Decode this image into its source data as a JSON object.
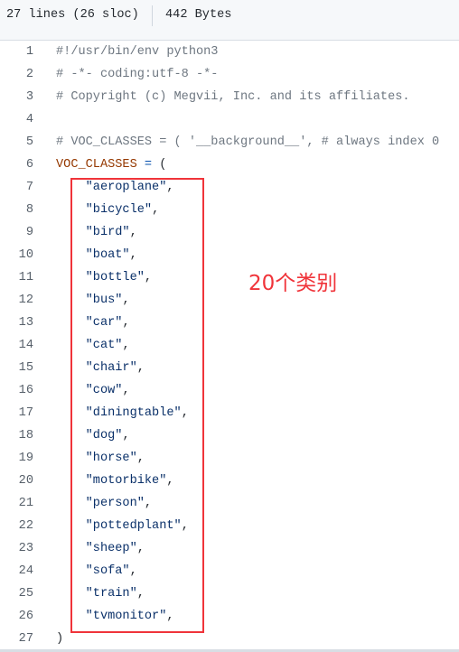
{
  "header": {
    "lines_info": "27 lines (26 sloc)",
    "size": "442 Bytes"
  },
  "code": {
    "line_numbers": [
      "1",
      "2",
      "3",
      "4",
      "5",
      "6",
      "7",
      "8",
      "9",
      "10",
      "11",
      "12",
      "13",
      "14",
      "15",
      "16",
      "17",
      "18",
      "19",
      "20",
      "21",
      "22",
      "23",
      "24",
      "25",
      "26",
      "27"
    ],
    "line1": "#!/usr/bin/env python3",
    "line2": "# -*- coding:utf-8 -*-",
    "line3": "# Copyright (c) Megvii, Inc. and its affiliates.",
    "line5": "# VOC_CLASSES = ( '__background__', # always index 0",
    "line6_var": "VOC_CLASSES",
    "line6_op": " = ",
    "line6_paren": "(",
    "classes": [
      "\"aeroplane\"",
      "\"bicycle\"",
      "\"bird\"",
      "\"boat\"",
      "\"bottle\"",
      "\"bus\"",
      "\"car\"",
      "\"cat\"",
      "\"chair\"",
      "\"cow\"",
      "\"diningtable\"",
      "\"dog\"",
      "\"horse\"",
      "\"motorbike\"",
      "\"person\"",
      "\"pottedplant\"",
      "\"sheep\"",
      "\"sofa\"",
      "\"train\"",
      "\"tvmonitor\""
    ],
    "comma": ",",
    "line27": ")"
  },
  "annotation": {
    "text": "20个类别",
    "color": "#f0343a"
  }
}
